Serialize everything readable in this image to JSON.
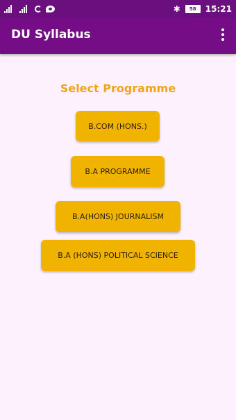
{
  "status_bar": {
    "time": "15:21",
    "battery": "58",
    "icons": [
      "signal-icon",
      "signal-icon",
      "sync-icon",
      "chat-icon",
      "bluetooth-icon",
      "battery-icon"
    ]
  },
  "app_bar": {
    "title": "DU Syllabus",
    "menu_icon": "overflow-menu-icon"
  },
  "main": {
    "heading": "Select Programme",
    "programmes": [
      "B.COM (HONS.)",
      "B.A PROGRAMME",
      "B.A(HONS) JOURNALISM",
      "B.A (HONS) POLITICAL SCIENCE"
    ]
  },
  "colors": {
    "app_bar": "#750e86",
    "status_bar": "#6b0f7f",
    "background": "#fdf1fd",
    "accent": "#f0a41b",
    "button": "#f0b400"
  }
}
